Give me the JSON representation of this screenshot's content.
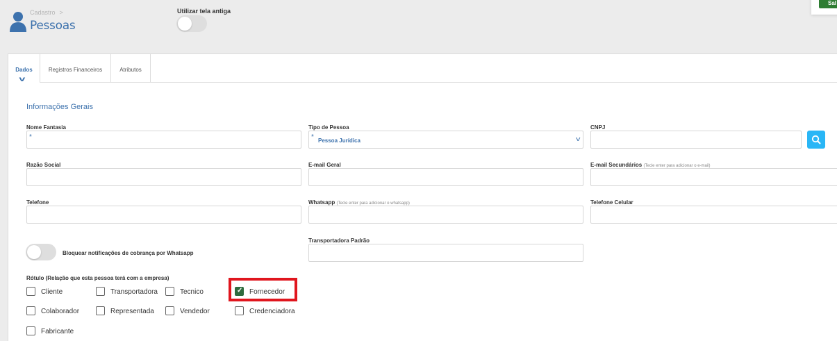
{
  "header": {
    "breadcrumb": "Cadastro",
    "breadcrumb_sep": ">",
    "title": "Pessoas",
    "old_screen_label": "Utilizar tela antiga",
    "old_screen_enabled": false,
    "save_label": "Sal"
  },
  "tabs": [
    {
      "label": "Dados",
      "active": true
    },
    {
      "label": "Registros Financeiros",
      "active": false
    },
    {
      "label": "Atributos",
      "active": false
    }
  ],
  "section": {
    "title": "Informações Gerais"
  },
  "fields": {
    "nome_fantasia": {
      "label": "Nome Fantasia",
      "value": "",
      "required": true
    },
    "tipo_pessoa": {
      "label": "Tipo de Pessoa",
      "value": "Pessoa Jurídica",
      "required": true
    },
    "cnpj": {
      "label": "CNPJ",
      "value": ""
    },
    "razao_social": {
      "label": "Razão Social",
      "value": ""
    },
    "email_geral": {
      "label": "E-mail Geral",
      "value": ""
    },
    "email_secundarios": {
      "label": "E-mail Secundários",
      "hint": "(Tecle enter para adicionar o e-mail)",
      "value": ""
    },
    "telefone": {
      "label": "Telefone",
      "value": ""
    },
    "whatsapp": {
      "label": "Whatsapp",
      "hint": "(Tecle enter para adicionar o whatsapp)",
      "value": ""
    },
    "telefone_celular": {
      "label": "Telefone Celular",
      "value": ""
    },
    "transportadora_padrao": {
      "label": "Transportadora Padrão",
      "value": ""
    }
  },
  "whatsapp_block": {
    "label": "Bloquear notificações de cobrança por Whatsapp",
    "enabled": false
  },
  "rotulo": {
    "label": "Rótulo (Relação que esta pessoa terá com a empresa)",
    "options": [
      {
        "label": "Cliente",
        "checked": false
      },
      {
        "label": "Transportadora",
        "checked": false
      },
      {
        "label": "Tecnico",
        "checked": false
      },
      {
        "label": "Fornecedor",
        "checked": true
      },
      {
        "label": "Colaborador",
        "checked": false
      },
      {
        "label": "Representada",
        "checked": false
      },
      {
        "label": "Vendedor",
        "checked": false
      },
      {
        "label": "Credenciadora",
        "checked": false
      },
      {
        "label": "Fabricante",
        "checked": false
      }
    ]
  },
  "icons": {
    "user": "user-icon",
    "search": "search-icon",
    "chevron": "chevron-down-icon"
  },
  "colors": {
    "accent": "#3d72ad",
    "search_button": "#29b6f6",
    "checked": "#2e6b3e",
    "highlight": "#e0161e",
    "save": "#2e7d32"
  }
}
